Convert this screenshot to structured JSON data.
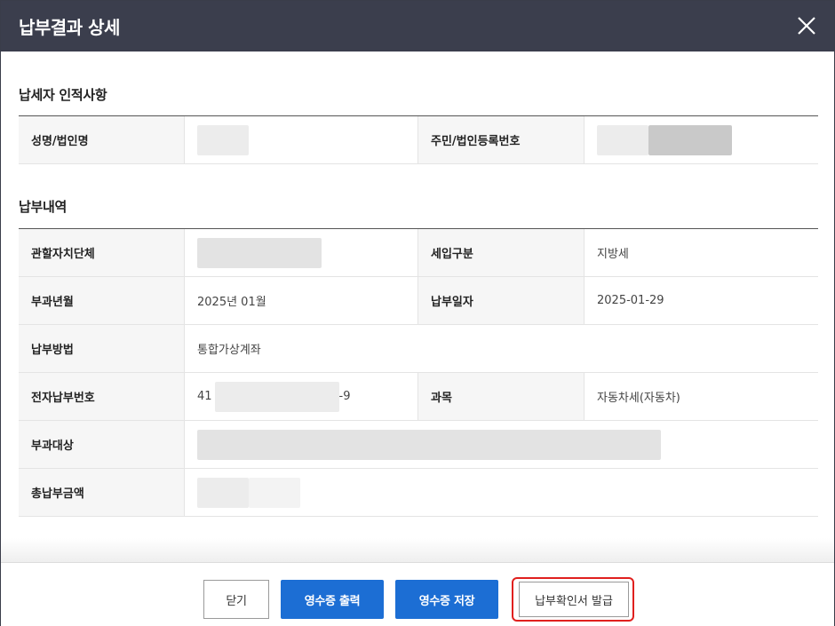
{
  "header": {
    "title": "납부결과 상세"
  },
  "section_taxpayer": {
    "title": "납세자 인적사항",
    "name_label": "성명/법인명",
    "name_value": "",
    "regno_label": "주민/법인등록번호",
    "regno_value": ""
  },
  "section_payment": {
    "title": "납부내역",
    "rows": {
      "authority_label": "관할자치단체",
      "authority_value": "",
      "revenue_type_label": "세입구분",
      "revenue_type_value": "지방세",
      "tax_period_label": "부과년월",
      "tax_period_value": "2025년 01월",
      "payment_date_label": "납부일자",
      "payment_date_value": "2025-01-29",
      "method_label": "납부방법",
      "method_value": "통합가상계좌",
      "epay_no_label": "전자납부번호",
      "epay_no_prefix": "41",
      "epay_no_suffix": "-9",
      "item_label": "과목",
      "item_value": "자동차세(자동차)",
      "target_label": "부과대상",
      "target_value": "",
      "total_label": "총납부금액",
      "total_value": ""
    }
  },
  "footer": {
    "close_label": "닫기",
    "print_label": "영수증 출력",
    "save_label": "영수증 저장",
    "issue_label": "납부확인서 발급"
  },
  "colors": {
    "header_bg": "#3b3e4d",
    "primary_button": "#1c6ed4",
    "highlight_border": "#e0201e"
  },
  "icons": {
    "close": "close-icon"
  }
}
